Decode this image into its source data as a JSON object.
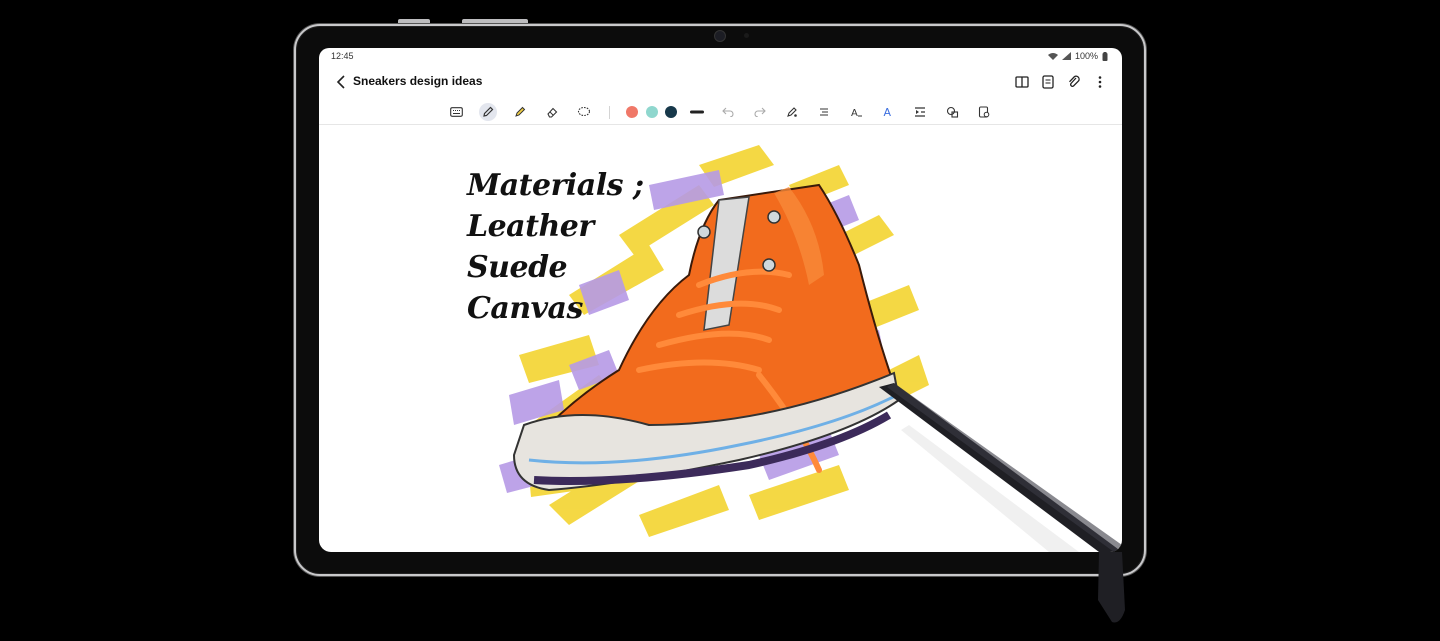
{
  "status": {
    "time": "12:45",
    "battery": "100%"
  },
  "note": {
    "title": "Sneakers design ideas"
  },
  "appbar_icons": [
    "book-view-icon",
    "page-layout-icon",
    "attach-icon",
    "more-options-icon"
  ],
  "toolbar": {
    "tools": [
      "keyboard-icon",
      "pen-icon",
      "highlighter-icon",
      "eraser-icon",
      "lasso-icon"
    ],
    "active_tool": "pen",
    "colors": [
      "#f07868",
      "#8fd7ce",
      "#17384a"
    ],
    "more_tools": [
      "undo-icon",
      "redo-icon",
      "pen-settings-icon",
      "text-align-icon",
      "text-style-icon",
      "handwriting-to-text-icon",
      "insert-icon",
      "shapes-icon",
      "lock-icon"
    ]
  },
  "canvas": {
    "handwriting": [
      "Materials ;",
      "Leather",
      "Suede",
      "Canvas"
    ]
  },
  "colors": {
    "orange": "#f26b1d",
    "yellow": "#f4d63a",
    "purple": "#b69ae6"
  }
}
